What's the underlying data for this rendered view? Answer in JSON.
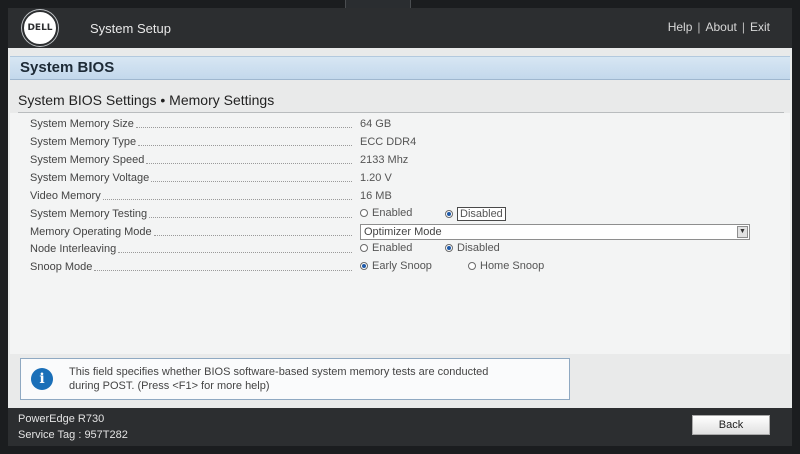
{
  "header": {
    "logo_text": "DELL",
    "app_title": "System Setup",
    "links": [
      "Help",
      "About",
      "Exit"
    ]
  },
  "section": {
    "title": "System BIOS"
  },
  "page": {
    "title": "System BIOS Settings • Memory Settings"
  },
  "settings": {
    "memory_size": {
      "label": "System Memory Size",
      "value": "64 GB"
    },
    "memory_type": {
      "label": "System Memory Type",
      "value": "ECC DDR4"
    },
    "memory_speed": {
      "label": "System Memory Speed",
      "value": "2133 Mhz"
    },
    "memory_voltage": {
      "label": "System Memory Voltage",
      "value": "1.20 V"
    },
    "video_memory": {
      "label": "Video Memory",
      "value": "16 MB"
    },
    "memory_testing": {
      "label": "System Memory Testing",
      "options": [
        "Enabled",
        "Disabled"
      ],
      "selected": "Disabled"
    },
    "operating_mode": {
      "label": "Memory Operating Mode",
      "selected": "Optimizer Mode"
    },
    "node_interleaving": {
      "label": "Node Interleaving",
      "options": [
        "Enabled",
        "Disabled"
      ],
      "selected": "Disabled"
    },
    "snoop_mode": {
      "label": "Snoop Mode",
      "options": [
        "Early Snoop",
        "Home Snoop"
      ],
      "selected": "Early Snoop"
    }
  },
  "help": {
    "line1": "This field specifies whether BIOS software-based system memory tests are conducted",
    "line2": "during POST. (Press <F1> for more help)"
  },
  "footer": {
    "model": "PowerEdge R730",
    "service_tag": "Service Tag : 957T282",
    "back_label": "Back"
  },
  "colors": {
    "header_bg": "#2c2e30",
    "section_bar": "#c3d8ec",
    "accent": "#1a6fb8"
  }
}
